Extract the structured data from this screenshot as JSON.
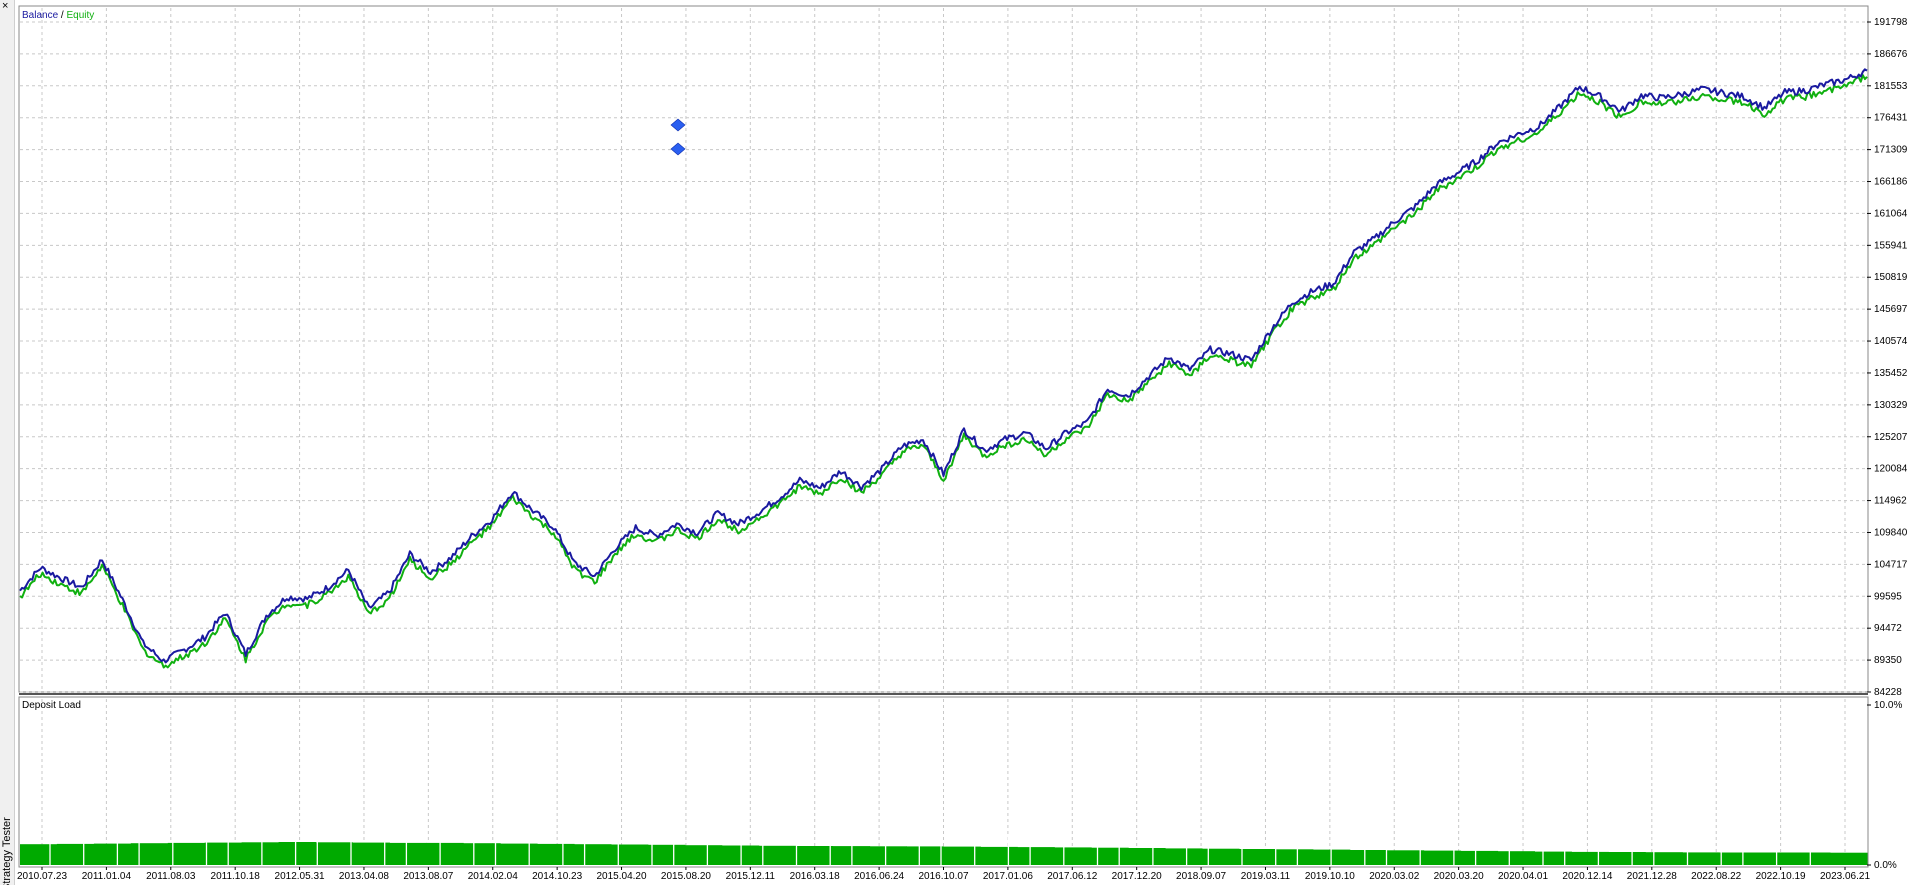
{
  "panel": {
    "title": "Strategy Tester",
    "close_icon": "close-icon"
  },
  "chart_data": [
    {
      "type": "line",
      "legend": {
        "balance_label": "Balance",
        "separator": " / ",
        "equity_label": "Equity",
        "placement": "top-left"
      },
      "colors": {
        "balance": "#1a1aa0",
        "equity": "#10b010",
        "grid": "#c8c8c8"
      },
      "grid": true,
      "y_tick_labels": [
        "191798",
        "186676",
        "181553",
        "176431",
        "171309",
        "166186",
        "161064",
        "155941",
        "150819",
        "145697",
        "140574",
        "135452",
        "130329",
        "125207",
        "120084",
        "114962",
        "109840",
        "104717",
        "99595",
        "94472",
        "89350",
        "84228"
      ],
      "ylim": [
        84228,
        191798
      ],
      "x_tick_labels": [
        "2010.07.23",
        "2011.01.04",
        "2011.08.03",
        "2011.10.18",
        "2012.05.31",
        "2013.04.08",
        "2013.08.07",
        "2014.02.04",
        "2014.10.23",
        "2015.04.20",
        "2015.08.20",
        "2015.12.11",
        "2016.03.18",
        "2016.06.24",
        "2016.10.07",
        "2017.01.06",
        "2017.06.12",
        "2017.12.20",
        "2018.09.07",
        "2019.03.11",
        "2019.10.10",
        "2020.03.02",
        "2020.03.20",
        "2020.04.01",
        "2020.12.14",
        "2021.12.28",
        "2022.08.22",
        "2022.10.19",
        "2023.06.21"
      ],
      "series": [
        {
          "name": "Balance",
          "values": [
            100500,
            104200,
            102500,
            101000,
            105500,
            99000,
            92000,
            89200,
            91000,
            93000,
            97000,
            90300,
            96500,
            99500,
            99200,
            101000,
            103800,
            97600,
            100300,
            106400,
            103500,
            105800,
            109200,
            112000,
            116400,
            113300,
            110700,
            105000,
            102800,
            107300,
            110600,
            109300,
            111200,
            109800,
            112900,
            111200,
            113100,
            115400,
            118200,
            117000,
            119700,
            117200,
            120000,
            123700,
            124800,
            119200,
            126400,
            123000,
            124800,
            125800,
            123300,
            125900,
            127500,
            132900,
            131800,
            134900,
            138000,
            136000,
            139200,
            138500,
            137500,
            142600,
            146800,
            148600,
            149800,
            154800,
            157000,
            159800,
            162200,
            165600,
            167500,
            169500,
            172400,
            173800,
            175000,
            178100,
            181400,
            179800,
            177500,
            180000,
            179600,
            180200,
            181000,
            180400,
            179800,
            178000,
            180500,
            180800,
            181800,
            182600,
            184000
          ]
        },
        {
          "name": "Equity",
          "values": [
            99500,
            103200,
            101500,
            100000,
            104500,
            98000,
            91000,
            88400,
            90000,
            92000,
            96000,
            89500,
            95500,
            98500,
            98200,
            100000,
            102800,
            96600,
            99300,
            105400,
            102500,
            104800,
            108200,
            111000,
            115400,
            112300,
            109700,
            104000,
            101800,
            106300,
            109600,
            108300,
            110200,
            108800,
            111900,
            110200,
            112100,
            114400,
            117200,
            116000,
            118700,
            116200,
            119000,
            122700,
            123800,
            118200,
            125400,
            122000,
            123800,
            124800,
            122300,
            124900,
            126500,
            131900,
            130800,
            133900,
            137000,
            135000,
            138200,
            137500,
            136500,
            141600,
            145800,
            147600,
            148800,
            153800,
            156000,
            158800,
            161200,
            164600,
            166500,
            168500,
            171400,
            172800,
            174000,
            177100,
            180400,
            178800,
            176500,
            179000,
            178600,
            179200,
            180000,
            179400,
            178800,
            177000,
            179500,
            179800,
            180800,
            181600,
            183000
          ]
        }
      ]
    },
    {
      "type": "bar",
      "title": "Deposit Load",
      "y_tick_labels": [
        "10.0%",
        "0.0%"
      ],
      "ylim": [
        0,
        10
      ],
      "colors": {
        "fill": "#00aa00"
      },
      "series": [
        {
          "name": "Deposit Load",
          "values": [
            1.3,
            1.32,
            1.34,
            1.36,
            1.38,
            1.4,
            1.42,
            1.44,
            1.42,
            1.4,
            1.38,
            1.38,
            1.36,
            1.34,
            1.32,
            1.3,
            1.28,
            1.26,
            1.24,
            1.22,
            1.2,
            1.19,
            1.18,
            1.17,
            1.16,
            1.15,
            1.13,
            1.12,
            1.1,
            1.08,
            1.06,
            1.04,
            1.02,
            1.0,
            0.98,
            0.96,
            0.94,
            0.92,
            0.9,
            0.88,
            0.86,
            0.84,
            0.82,
            0.81,
            0.8,
            0.79,
            0.78,
            0.78,
            0.78,
            0.77
          ]
        }
      ]
    }
  ],
  "markers": {
    "icon": "diamond-marker-icon",
    "count": 2,
    "color": "#2a5ff0"
  }
}
